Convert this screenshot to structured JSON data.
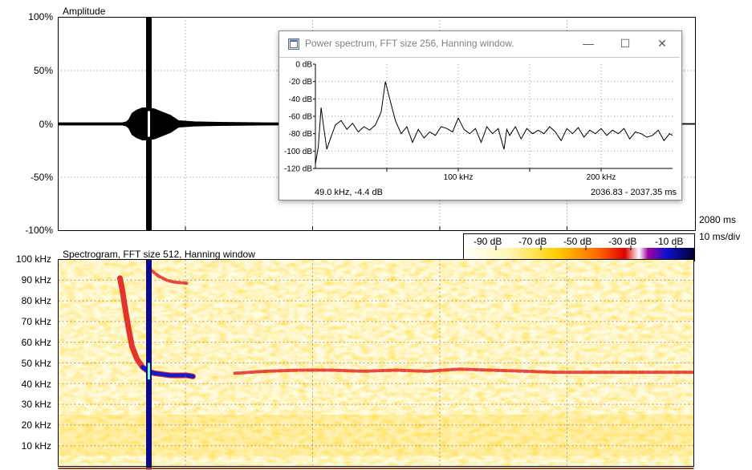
{
  "amplitude": {
    "title": "Amplitude",
    "y_ticks": [
      "100%",
      "50%",
      "0%",
      "-50%",
      "-100%"
    ],
    "time_label": "2080 ms",
    "scale_label": "10 ms/div"
  },
  "spectrogram": {
    "title": "Spectrogram, FFT size 512, Hanning window",
    "y_ticks": [
      "100 kHz",
      "90 kHz",
      "80 kHz",
      "70 kHz",
      "60 kHz",
      "50 kHz",
      "40 kHz",
      "30 kHz",
      "20 kHz",
      "10 kHz"
    ],
    "colorbar_labels": [
      "-90 dB",
      "-70 dB",
      "-50 dB",
      "-30 dB",
      "-10 dB"
    ]
  },
  "power_spectrum": {
    "window_title": "Power spectrum, FFT size 256, Hanning window.",
    "minimize_label": "—",
    "maximize_label": "☐",
    "close_label": "✕",
    "cursor_readout": "49.0 kHz, -4.4 dB",
    "time_range": "2036.83 - 2037.35 ms"
  },
  "colors": {
    "background": "#ffffff",
    "waveform": "#000000",
    "grid": "#808080",
    "spec_low": "#fffbe0",
    "spec_mid": "#ffd21e",
    "spec_high": "#e01010",
    "spec_peak": "#1a1ac8"
  },
  "chart_data": [
    {
      "type": "line",
      "name": "power spectrum",
      "x_unit": "kHz",
      "y_unit": "dB",
      "x_ticks": [
        "100 kHz",
        "200 kHz"
      ],
      "y_ticks": [
        "0 dB",
        "-20 dB",
        "-40 dB",
        "-60 dB",
        "-80 dB",
        "-100 dB",
        "-120 dB"
      ],
      "xlim": [
        0,
        250
      ],
      "ylim": [
        -120,
        0
      ],
      "grid": true,
      "x": [
        0,
        2,
        4,
        6,
        8,
        10,
        14,
        18,
        22,
        26,
        30,
        34,
        38,
        42,
        46,
        49,
        52,
        56,
        60,
        64,
        68,
        72,
        76,
        80,
        84,
        88,
        92,
        96,
        100,
        104,
        108,
        112,
        116,
        120,
        124,
        128,
        132,
        134,
        136,
        140,
        144,
        148,
        152,
        156,
        160,
        164,
        168,
        172,
        176,
        180,
        184,
        188,
        192,
        196,
        200,
        204,
        208,
        212,
        216,
        220,
        224,
        228,
        232,
        236,
        240,
        244,
        248,
        250
      ],
      "y": [
        -115,
        -95,
        -50,
        -75,
        -98,
        -88,
        -70,
        -65,
        -75,
        -68,
        -78,
        -72,
        -76,
        -70,
        -55,
        -20,
        -40,
        -65,
        -80,
        -72,
        -90,
        -75,
        -85,
        -78,
        -82,
        -72,
        -74,
        -78,
        -62,
        -75,
        -80,
        -74,
        -90,
        -72,
        -80,
        -74,
        -98,
        -75,
        -82,
        -72,
        -86,
        -74,
        -80,
        -76,
        -80,
        -72,
        -78,
        -88,
        -74,
        -80,
        -73,
        -84,
        -76,
        -80,
        -74,
        -82,
        -76,
        -80,
        -74,
        -86,
        -78,
        -80,
        -84,
        -82,
        -76,
        -88,
        -80,
        -82
      ]
    },
    {
      "type": "line",
      "name": "amplitude waveform",
      "x_unit": "ms",
      "y_unit": "%",
      "y_ticks": [
        "100%",
        "50%",
        "0%",
        "-50%",
        "-100%"
      ],
      "ylim": [
        -100,
        100
      ],
      "grid": true,
      "envelope_x": [
        0,
        80,
        85,
        88,
        92,
        98,
        105,
        112,
        120,
        140,
        150,
        170,
        200,
        260,
        400,
        600,
        794
      ],
      "envelope_y": [
        1,
        1,
        2,
        4,
        10,
        13,
        15,
        15,
        14,
        8,
        3,
        2,
        1.5,
        1,
        0.6,
        0.4,
        0.3
      ]
    },
    {
      "type": "heatmap",
      "name": "spectrogram",
      "y_unit": "kHz",
      "ylim": [
        0,
        100
      ],
      "value_unit": "dB",
      "value_range": [
        -90,
        -10
      ],
      "grid": true,
      "tracks": [
        {
          "x": [
            77,
            80,
            84,
            88,
            92,
            98,
            105,
            112,
            120,
            130,
            140,
            150,
            160,
            168
          ],
          "y": [
            91,
            85,
            75,
            66,
            58,
            52,
            48,
            46,
            45,
            44.5,
            44,
            44,
            44,
            43.5
          ],
          "level": "strong"
        },
        {
          "x": [
            115,
            125,
            135,
            145,
            160
          ],
          "y": [
            95,
            92,
            90,
            89,
            88.5
          ],
          "level": "medium"
        },
        {
          "x": [
            220,
            260,
            300,
            340,
            380,
            420,
            460,
            500,
            540,
            580,
            620,
            660,
            700,
            740,
            790
          ],
          "y": [
            45,
            46,
            46.5,
            46.5,
            46,
            46.5,
            46,
            47,
            46.5,
            46,
            45.5,
            45.5,
            45.5,
            45.5,
            45.5
          ],
          "level": "medium"
        }
      ]
    }
  ]
}
